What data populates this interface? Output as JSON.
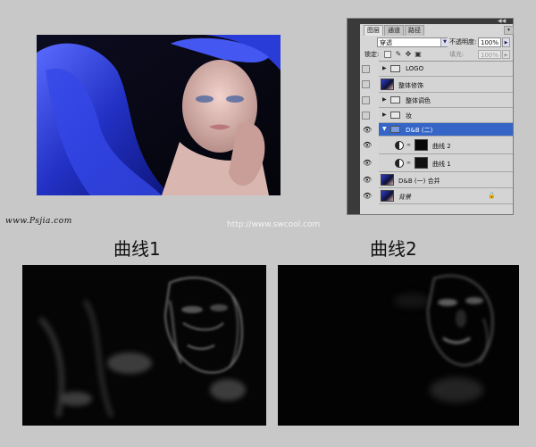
{
  "watermark_left": "www.Psjia.com",
  "watermark_center": "http://www.swcool.com",
  "captions": {
    "curve1": "曲线1",
    "curve2": "曲线2"
  },
  "layers_panel": {
    "tabs": [
      {
        "label": "图层",
        "active": true
      },
      {
        "label": "通道",
        "active": false
      },
      {
        "label": "路径",
        "active": false
      }
    ],
    "collapse_glyph": "◀◀",
    "blend_mode": "穿透",
    "opacity_label": "不透明度:",
    "opacity_value": "100%",
    "lock_label": "锁定:",
    "fill_label": "填充:",
    "fill_value": "100%",
    "layers": [
      {
        "name": "LOGO",
        "kind": "group",
        "visible": false,
        "selected": false,
        "expanded": false
      },
      {
        "name": "整体修饰",
        "kind": "image",
        "visible": false,
        "selected": false
      },
      {
        "name": "整体调色",
        "kind": "group",
        "visible": false,
        "selected": false,
        "expanded": false
      },
      {
        "name": "妆",
        "kind": "group",
        "visible": false,
        "selected": false,
        "expanded": false
      },
      {
        "name": "D&B (二)",
        "kind": "group",
        "visible": true,
        "selected": true,
        "expanded": true
      },
      {
        "name": "曲线 2",
        "kind": "adjustment",
        "visible": true,
        "selected": false
      },
      {
        "name": "曲线 1",
        "kind": "adjustment",
        "visible": true,
        "selected": false
      },
      {
        "name": "D&B (一) 合并",
        "kind": "image",
        "visible": true,
        "selected": false
      },
      {
        "name": "背景",
        "kind": "image",
        "visible": true,
        "selected": false,
        "italic": true,
        "locked": true
      }
    ]
  },
  "colors": {
    "background": "#c8c8c8",
    "selection": "#3465c7",
    "silk": "#2a3fd0"
  }
}
